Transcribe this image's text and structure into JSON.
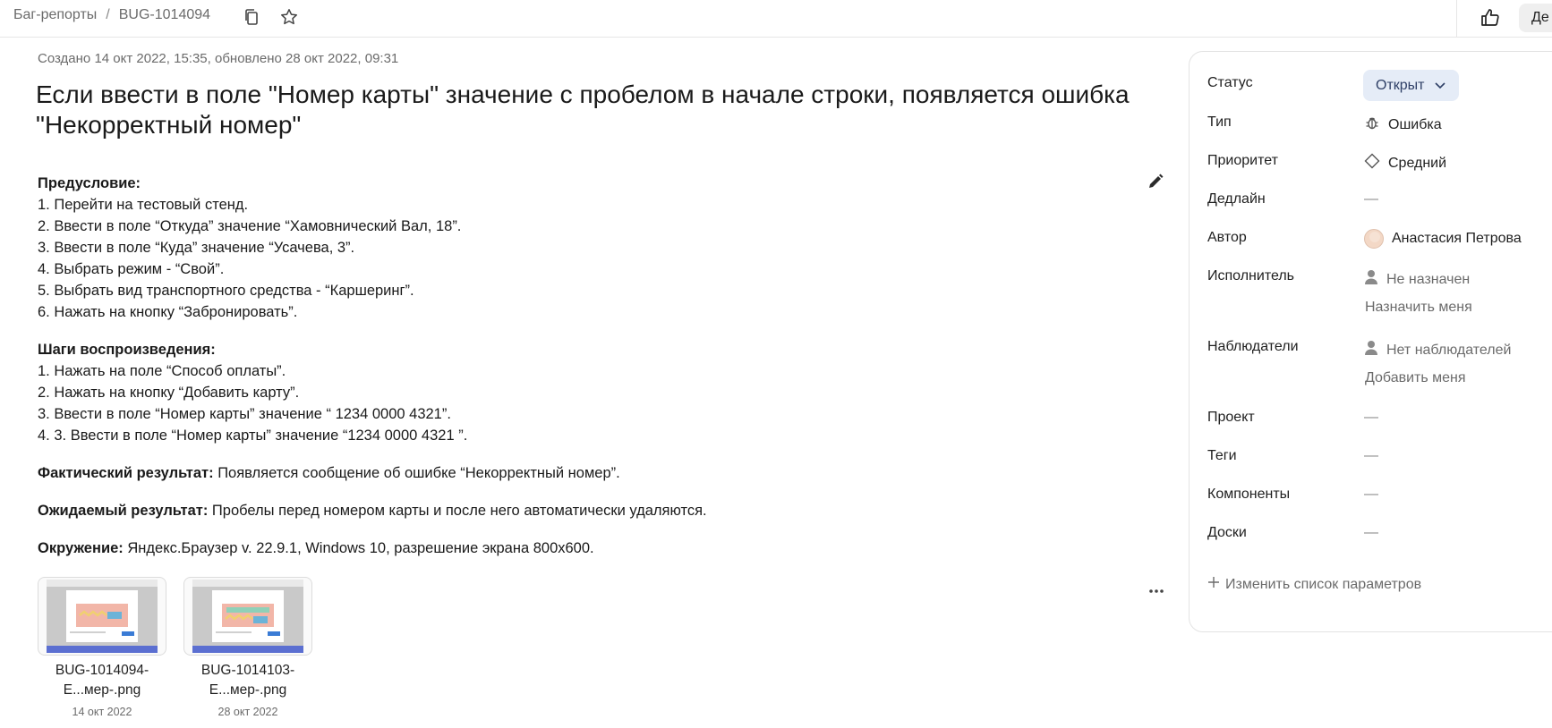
{
  "breadcrumb": {
    "parent": "Баг-репорты",
    "separator": "/",
    "current": "BUG-1014094"
  },
  "header": {
    "action_label": "Де"
  },
  "issue": {
    "meta": "Создано 14 окт 2022, 15:35, обновлено 28 окт 2022, 09:31",
    "title": "Если ввести в поле \"Номер карты\" значение с пробелом в начале строки, появляется ошибка \"Некорректный номер\""
  },
  "description": {
    "preconditions": {
      "heading": "Предусловие:",
      "items": [
        "1. Перейти на тестовый стенд.",
        "2. Ввести в поле “Откуда” значение “Хамовнический Вал, 18”.",
        "3. Ввести в поле “Куда” значение “Усачева, 3”.",
        "4. Выбрать режим - “Свой”.",
        "5. Выбрать вид транспортного средства - “Каршеринг”.",
        "6. Нажать на кнопку “Забронировать”."
      ]
    },
    "steps": {
      "heading": "Шаги воспроизведения:",
      "items": [
        "1. Нажать на поле “Способ оплаты”.",
        "2. Нажать на кнопку “Добавить карту”.",
        "3. Ввести в поле “Номер карты” значение “ 1234 0000 4321”.",
        "4. 3. Ввести в поле “Номер карты” значение “1234 0000 4321 ”."
      ]
    },
    "actual": {
      "label": "Фактический результат:",
      "text": " Появляется сообщение об ошибке “Некорректный номер”."
    },
    "expected": {
      "label": "Ожидаемый результат:",
      "text": " Пробелы перед номером карты и после него автоматически удаляются."
    },
    "environment": {
      "label": "Окружение:",
      "text": " Яндекс.Браузер v. 22.9.1, Windows 10, разрешение экрана 800x600."
    }
  },
  "attachments": [
    {
      "name_line1": "BUG-1014094-",
      "name_line2": "E...мер-.png",
      "date": "14 окт 2022"
    },
    {
      "name_line1": "BUG-1014103-",
      "name_line2": "E...мер-.png",
      "date": "28 окт 2022"
    }
  ],
  "sidebar": {
    "status": {
      "label": "Статус",
      "value": "Открыт"
    },
    "type": {
      "label": "Тип",
      "value": "Ошибка"
    },
    "priority": {
      "label": "Приоритет",
      "value": "Средний"
    },
    "deadline": {
      "label": "Дедлайн",
      "value": "—"
    },
    "author": {
      "label": "Автор",
      "value": "Анастасия Петрова"
    },
    "assignee": {
      "label": "Исполнитель",
      "value": "Не назначен",
      "action": "Назначить меня"
    },
    "watchers": {
      "label": "Наблюдатели",
      "value": "Нет наблюдателей",
      "action": "Добавить меня"
    },
    "project": {
      "label": "Проект",
      "value": "—"
    },
    "tags": {
      "label": "Теги",
      "value": "—"
    },
    "components": {
      "label": "Компоненты",
      "value": "—"
    },
    "boards": {
      "label": "Доски",
      "value": "—"
    },
    "change_params": "Изменить список параметров"
  },
  "colors": {
    "status_bg": "#e5ecf7",
    "status_text": "#2e3f66",
    "muted": "#6b6b6b"
  }
}
